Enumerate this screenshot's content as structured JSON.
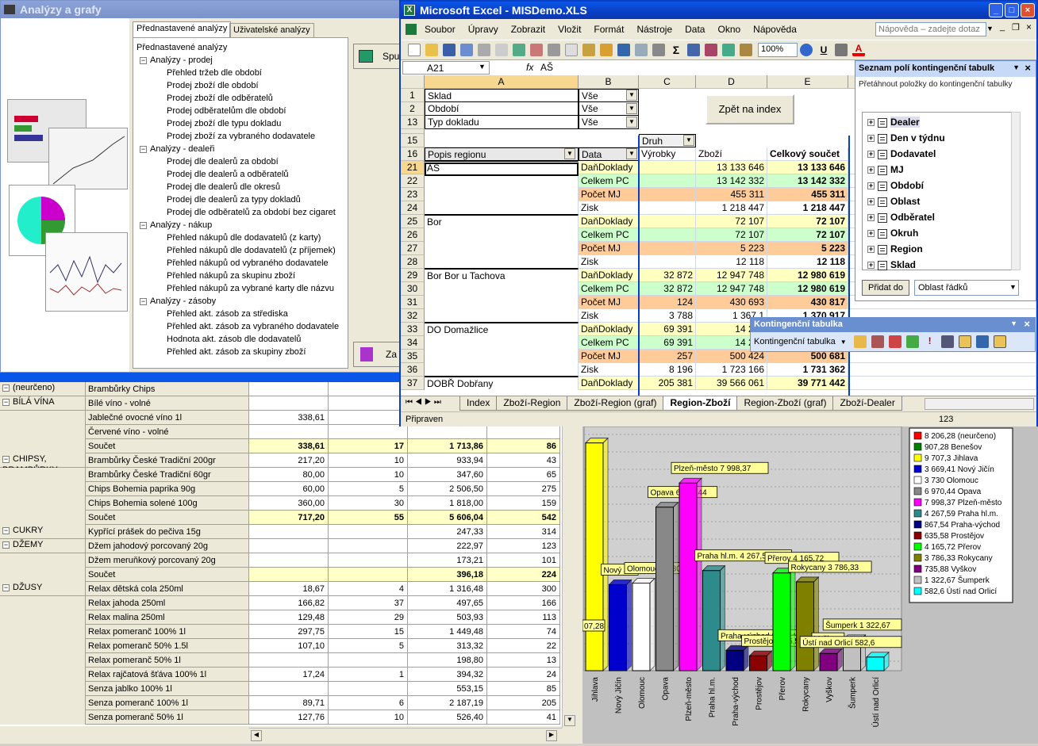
{
  "analyzy": {
    "title": "Analýzy a grafy",
    "tabs": [
      "Přednastavené analýzy",
      "Uživatelské analýzy"
    ],
    "tree_root": "Přednastavené analýzy",
    "tree": [
      {
        "group": "Analýzy - prodej",
        "items": [
          "Přehled tržeb dle období",
          "Prodej zboží dle období",
          "Prodej zboží dle odběratelů",
          "Prodej odběratelům dle období",
          "Prodej zboží dle typu dokladu",
          "Prodej zboží za vybraného dodavatele"
        ]
      },
      {
        "group": "Analýzy - dealeři",
        "items": [
          "Prodej dle dealerů za období",
          "Prodej dle dealerů a odběratelů",
          "Prodej dle dealerů dle okresů",
          "Prodej dle dealerů za typy dokladů",
          "Prodej dle odběratelů za období bez cigaret"
        ]
      },
      {
        "group": "Analýzy - nákup",
        "items": [
          "Přehled nákupů dle dodavatelů (z karty)",
          "Přehled nákupů dle dodavatelů (z příjemek)",
          "Přehled nákupů od vybraného dodavatele",
          "Přehled nákupů za skupinu zboží",
          "Přehled nákupů za vybrané karty dle názvu"
        ]
      },
      {
        "group": "Analýzy - zásoby",
        "items": [
          "Přehled akt. zásob za střediska",
          "Přehled akt. zásob za vybraného dodavatele",
          "Hodnota akt. zásob dle dodavatelů",
          "Přehled akt. zásob za skupiny zboží"
        ]
      }
    ],
    "btn_spustit": "Spu",
    "btn_zavrit": "Za"
  },
  "grid": {
    "rows": [
      {
        "group": "(neurčeno)",
        "name": "Brambůrky Chips",
        "v1": "",
        "v2": "",
        "v3": "",
        "v4": ""
      },
      {
        "group": "BÍLÁ VÍNA",
        "name": "Bílé víno - volné",
        "v1": "",
        "v2": "",
        "v3": "",
        "v4": ""
      },
      {
        "group": "",
        "name": "Jablečné ovocné víno 1l",
        "v1": "338,61",
        "v2": "",
        "v3": "",
        "v4": ""
      },
      {
        "group": "",
        "name": "Červené víno - volné",
        "v1": "",
        "v2": "",
        "v3": "",
        "v4": ""
      },
      {
        "group": "",
        "name": "Součet",
        "v1": "338,61",
        "v2": "17",
        "v3": "1 713,86",
        "v4": "86",
        "sum": true
      },
      {
        "group": "CHIPSY, BRAMBŮRKY, KŘUPKY",
        "name": "Brambůrky České Tradiční 200gr",
        "v1": "217,20",
        "v2": "10",
        "v3": "933,94",
        "v4": "43"
      },
      {
        "group": "",
        "name": "Brambůrky České Tradiční 60gr",
        "v1": "80,00",
        "v2": "10",
        "v3": "347,60",
        "v4": "65"
      },
      {
        "group": "",
        "name": "Chips Bohemia paprika 90g",
        "v1": "60,00",
        "v2": "5",
        "v3": "2 506,50",
        "v4": "275"
      },
      {
        "group": "",
        "name": "Chips Bohemia solené 100g",
        "v1": "360,00",
        "v2": "30",
        "v3": "1 818,00",
        "v4": "159"
      },
      {
        "group": "",
        "name": "Součet",
        "v1": "717,20",
        "v2": "55",
        "v3": "5 606,04",
        "v4": "542",
        "sum": true
      },
      {
        "group": "CUKRY",
        "name": "Kypřící prášek do pečiva 15g",
        "v1": "",
        "v2": "",
        "v3": "247,33",
        "v4": "314"
      },
      {
        "group": "DŽEMY",
        "name": "Džem jahodový porcovaný 20g",
        "v1": "",
        "v2": "",
        "v3": "222,97",
        "v4": "123"
      },
      {
        "group": "",
        "name": "Džem meruňkový porcovaný 20g",
        "v1": "",
        "v2": "",
        "v3": "173,21",
        "v4": "101"
      },
      {
        "group": "",
        "name": "Součet",
        "v1": "",
        "v2": "",
        "v3": "396,18",
        "v4": "224",
        "sum": true
      },
      {
        "group": "DŽUSY",
        "name": "Relax dětská cola 250ml",
        "v1": "18,67",
        "v2": "4",
        "v3": "1 316,48",
        "v4": "300"
      },
      {
        "group": "",
        "name": "Relax jahoda 250ml",
        "v1": "166,82",
        "v2": "37",
        "v3": "497,65",
        "v4": "166"
      },
      {
        "group": "",
        "name": "Relax malina 250ml",
        "v1": "129,48",
        "v2": "29",
        "v3": "503,93",
        "v4": "113"
      },
      {
        "group": "",
        "name": "Relax pomeranč 100% 1l",
        "v1": "297,75",
        "v2": "15",
        "v3": "1 449,48",
        "v4": "74"
      },
      {
        "group": "",
        "name": "Relax pomeranč 50% 1.5l",
        "v1": "107,10",
        "v2": "5",
        "v3": "313,32",
        "v4": "22"
      },
      {
        "group": "",
        "name": "Relax pomeranč 50% 1l",
        "v1": "",
        "v2": "",
        "v3": "198,80",
        "v4": "13"
      },
      {
        "group": "",
        "name": "Relax rajčatová šťáva 100% 1l",
        "v1": "17,24",
        "v2": "1",
        "v3": "394,32",
        "v4": "24"
      },
      {
        "group": "",
        "name": "Senza jablko 100% 1l",
        "v1": "",
        "v2": "",
        "v3": "553,15",
        "v4": "85"
      },
      {
        "group": "",
        "name": "Senza pomeranč 100% 1l",
        "v1": "89,71",
        "v2": "6",
        "v3": "2 187,19",
        "v4": "205"
      },
      {
        "group": "",
        "name": "Senza pomeranč 50% 1l",
        "v1": "127,76",
        "v2": "10",
        "v3": "526,40",
        "v4": "41"
      }
    ]
  },
  "excel": {
    "title": "Microsoft Excel - MISDemo.XLS",
    "menu": [
      "Soubor",
      "Úpravy",
      "Zobrazit",
      "Vložit",
      "Formát",
      "Nástroje",
      "Data",
      "Okno",
      "Nápověda"
    ],
    "help_placeholder": "Nápověda – zadejte dotaz",
    "zoom": "100%",
    "name_box": "A21",
    "formula": "AŠ",
    "fx": "fx",
    "col_headers": [
      "A",
      "B",
      "C",
      "D",
      "E"
    ],
    "filters": [
      {
        "row": "1",
        "label": "Sklad",
        "value": "Vše"
      },
      {
        "row": "2",
        "label": "Období",
        "value": "Vše"
      },
      {
        "row": "13",
        "label": "Typ dokladu",
        "value": "Vše"
      }
    ],
    "btn_zpet": "Zpět na index",
    "row14": "14",
    "row15": "15",
    "druh": "Druh",
    "row16": "16",
    "hdr_popis": "Popis regionu",
    "hdr_data": "Data",
    "hdr_vyrobky": "Výrobky",
    "hdr_zbozi": "Zboží",
    "hdr_celkem": "Celkový součet",
    "rows": [
      {
        "n": "21",
        "a": "AŠ",
        "b": "DaňDoklady",
        "c": "",
        "d": "13 133 646",
        "e": "13 133 646",
        "k": "y"
      },
      {
        "n": "22",
        "a": "",
        "b": "Celkem PC",
        "c": "",
        "d": "13 142 332",
        "e": "13 142 332",
        "k": "g"
      },
      {
        "n": "23",
        "a": "",
        "b": "Počet MJ",
        "c": "",
        "d": "455 311",
        "e": "455 311",
        "k": "o"
      },
      {
        "n": "24",
        "a": "",
        "b": "Zisk",
        "c": "",
        "d": "1 218 447",
        "e": "1 218 447",
        "k": "w"
      },
      {
        "n": "25",
        "a": "Bor",
        "b": "DaňDoklady",
        "c": "",
        "d": "72 107",
        "e": "72 107",
        "k": "y"
      },
      {
        "n": "26",
        "a": "",
        "b": "Celkem PC",
        "c": "",
        "d": "72 107",
        "e": "72 107",
        "k": "g"
      },
      {
        "n": "27",
        "a": "",
        "b": "Počet MJ",
        "c": "",
        "d": "5 223",
        "e": "5 223",
        "k": "o"
      },
      {
        "n": "28",
        "a": "",
        "b": "Zisk",
        "c": "",
        "d": "12 118",
        "e": "12 118",
        "k": "w"
      },
      {
        "n": "29",
        "a": "Bor Bor u Tachova",
        "b": "DaňDoklady",
        "c": "32 872",
        "d": "12 947 748",
        "e": "12 980 619",
        "k": "y"
      },
      {
        "n": "30",
        "a": "",
        "b": "Celkem PC",
        "c": "32 872",
        "d": "12 947 748",
        "e": "12 980 619",
        "k": "g"
      },
      {
        "n": "31",
        "a": "",
        "b": "Počet MJ",
        "c": "124",
        "d": "430 693",
        "e": "430 817",
        "k": "o"
      },
      {
        "n": "32",
        "a": "",
        "b": "Zisk",
        "c": "3 788",
        "d": "1 367 1",
        "e": "1 370 917",
        "k": "w"
      },
      {
        "n": "33",
        "a": "DO Domažlice",
        "b": "DaňDoklady",
        "c": "69 391",
        "d": "14 280",
        "e": "",
        "k": "y"
      },
      {
        "n": "34",
        "a": "",
        "b": "Celkem PC",
        "c": "69 391",
        "d": "14 280",
        "e": "",
        "k": "g"
      },
      {
        "n": "35",
        "a": "",
        "b": "Počet MJ",
        "c": "257",
        "d": "500 424",
        "e": "500 681",
        "k": "o"
      },
      {
        "n": "36",
        "a": "",
        "b": "Zisk",
        "c": "8 196",
        "d": "1 723 166",
        "e": "1 731 362",
        "k": "w"
      },
      {
        "n": "37",
        "a": "DOBŘ Dobřany",
        "b": "DaňDoklady",
        "c": "205 381",
        "d": "39 566 061",
        "e": "39 771 442",
        "k": "y"
      }
    ],
    "sheet_tabs": [
      "Index",
      "Zboží-Region",
      "Zboží-Region (graf)",
      "Region-Zboží",
      "Region-Zboží (graf)",
      "Zboží-Dealer"
    ],
    "active_tab": "Region-Zboží",
    "status": "Připraven",
    "status_num": "123",
    "field_list": {
      "title": "Seznam polí kontingenční tabulk",
      "hint": "Přetáhnout položky do kontingenční tabulky",
      "fields": [
        "Dealer",
        "Den v týdnu",
        "Dodavatel",
        "MJ",
        "Období",
        "Oblast",
        "Odběratel",
        "Okruh",
        "Region",
        "Sklad"
      ],
      "add_btn": "Přidat do",
      "area": "Oblast řádků"
    },
    "pivot_toolbar": {
      "title": "Kontingenční tabulka",
      "menu": "Kontingenční tabulka"
    }
  },
  "chart_data": {
    "type": "bar",
    "categories": [
      "Jihlava",
      "Nový Jičín",
      "Olomouc",
      "Opava",
      "Plzeň-město",
      "Praha hl.m.",
      "Praha-východ",
      "Prostějov",
      "Přerov",
      "Rokycany",
      "Vyškov",
      "Šumperk",
      "Ústí nad Orlicí"
    ],
    "values": [
      9707.3,
      3669.41,
      3730,
      6970.44,
      7998.37,
      4267.59,
      867.54,
      635.58,
      4165.72,
      3786.33,
      735.88,
      1322.67,
      582.6
    ],
    "colors": [
      "#ffff00",
      "#0000cc",
      "#ffffff",
      "#888888",
      "#ff00ff",
      "#2e8b8b",
      "#000080",
      "#8b0000",
      "#00ff00",
      "#808000",
      "#800080",
      "#c0c0c0",
      "#00ffff"
    ],
    "bar_labels": [
      "",
      "Nový Ji",
      "Olomouc 3 730",
      "Opava 6 970,44",
      "Plzeň-město 7 998,37",
      "Praha hl.m. 4 267,59",
      "Praha-východ 867,54",
      "Prostějov 635,58",
      "Přerov 4 165,72",
      "Rokycany 3 786,33",
      "Vyškov",
      "Šumperk 1 322,67",
      "Ústí nad Orlicí 582,6"
    ],
    "extra_label": "07,28",
    "legend": [
      "8 206,28 (neurčeno)",
      "907,28 Benešov",
      "9 707,3 Jihlava",
      "3 669,41 Nový Jičín",
      "3 730 Olomouc",
      "6 970,44 Opava",
      "7 998,37 Plzeň-město",
      "4 267,59 Praha hl.m.",
      "867,54 Praha-východ",
      "635,58 Prostějov",
      "4 165,72 Přerov",
      "3 786,33 Rokycany",
      "735,88 Vyškov",
      "1 322,67 Šumperk",
      "582,6 Ústí nad Orlicí"
    ],
    "legend_colors": [
      "#ff0000",
      "#008000",
      "#ffff00",
      "#0000cc",
      "#ffffff",
      "#888888",
      "#ff00ff",
      "#2e8b8b",
      "#000080",
      "#8b0000",
      "#00ff00",
      "#808000",
      "#800080",
      "#c0c0c0",
      "#00ffff"
    ],
    "ylim": [
      0,
      10000
    ],
    "legend_position": "right"
  }
}
